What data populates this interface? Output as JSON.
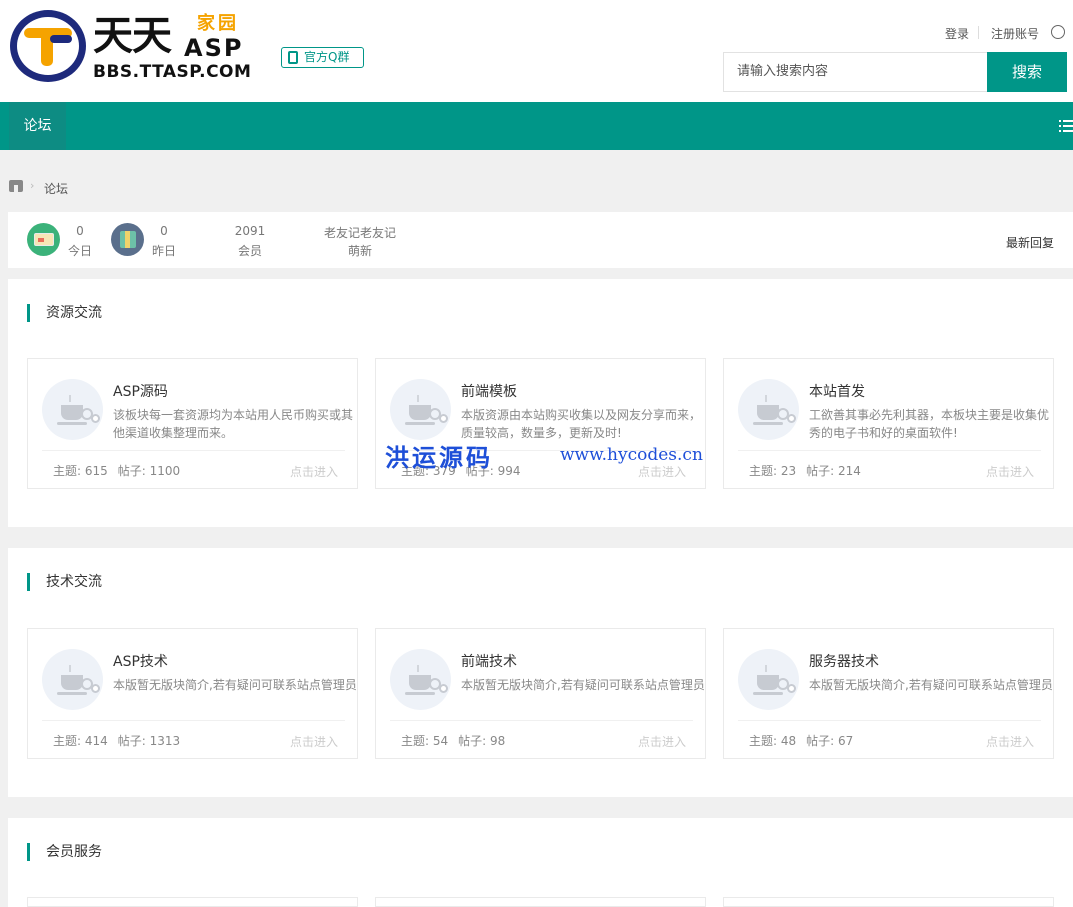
{
  "header": {
    "logo": {
      "name_cn": "天天",
      "suffix_cn": "家园",
      "asp": "ASP",
      "url": "BBS.TTASP.COM"
    },
    "qq_group_label": "官方Q群",
    "login_label": "登录",
    "register_label": "注册账号",
    "search": {
      "placeholder": "请输入搜索内容",
      "button_label": "搜索"
    }
  },
  "nav": {
    "items": [
      {
        "label": "论坛"
      }
    ]
  },
  "breadcrumb": {
    "current": "论坛"
  },
  "stats": {
    "today": {
      "value": "0",
      "label": "今日"
    },
    "yesterday": {
      "value": "0",
      "label": "昨日"
    },
    "members": {
      "value": "2091",
      "label": "会员"
    },
    "newest": {
      "value": "老友记老友记",
      "label": "萌新"
    },
    "latest_reply_label": "最新回复"
  },
  "sections": [
    {
      "title": "资源交流",
      "forums": [
        {
          "name": "ASP源码",
          "desc": "该板块每一套资源均为本站用人民币购买或其他渠道收集整理而来。",
          "topics_label": "主题:",
          "topics": "615",
          "posts_label": "帖子:",
          "posts": "1100",
          "enter": "点击进入"
        },
        {
          "name": "前端模板",
          "desc": "本版资源由本站购买收集以及网友分享而来，质量较高，数量多，更新及时!",
          "topics_label": "主题:",
          "topics": "379",
          "posts_label": "帖子:",
          "posts": "994",
          "enter": "点击进入"
        },
        {
          "name": "本站首发",
          "desc": "工欲善其事必先利其器，本板块主要是收集优秀的电子书和好的桌面软件!",
          "topics_label": "主题:",
          "topics": "23",
          "posts_label": "帖子:",
          "posts": "214",
          "enter": "点击进入"
        }
      ]
    },
    {
      "title": "技术交流",
      "forums": [
        {
          "name": "ASP技术",
          "desc": "本版暂无版块简介,若有疑问可联系站点管理员",
          "topics_label": "主题:",
          "topics": "414",
          "posts_label": "帖子:",
          "posts": "1313",
          "enter": "点击进入"
        },
        {
          "name": "前端技术",
          "desc": "本版暂无版块简介,若有疑问可联系站点管理员",
          "topics_label": "主题:",
          "topics": "54",
          "posts_label": "帖子:",
          "posts": "98",
          "enter": "点击进入"
        },
        {
          "name": "服务器技术",
          "desc": "本版暂无版块简介,若有疑问可联系站点管理员",
          "topics_label": "主题:",
          "topics": "48",
          "posts_label": "帖子:",
          "posts": "67",
          "enter": "点击进入"
        }
      ]
    },
    {
      "title": "会员服务"
    }
  ],
  "watermark": {
    "cn": "洪运源码",
    "url": "www.hycodes.cn"
  },
  "colors": {
    "accent": "#009688",
    "page_bg": "#f0f0f0"
  }
}
